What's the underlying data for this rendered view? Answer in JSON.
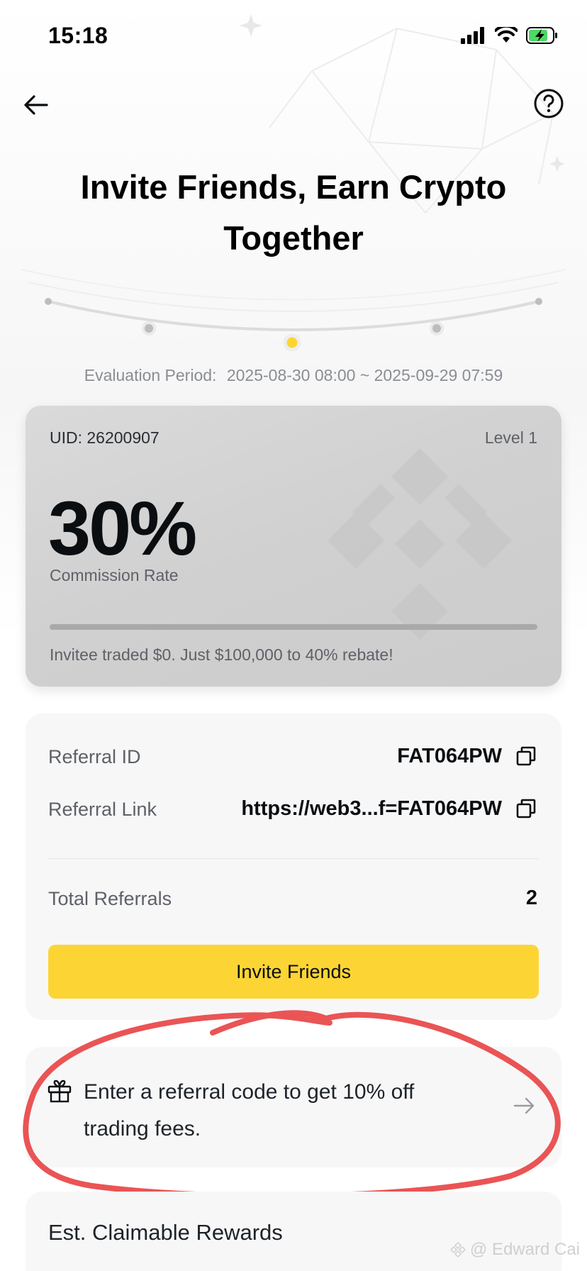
{
  "status_bar": {
    "time": "15:18",
    "icons": [
      "signal-icon",
      "wifi-icon",
      "battery-charging-icon"
    ]
  },
  "header": {
    "back_icon": "arrow-left-icon",
    "help_icon": "question-circle-icon",
    "title": "Invite Friends, Earn Crypto Together"
  },
  "evaluation": {
    "label": "Evaluation Period:",
    "value": "2025-08-30 08:00 ~ 2025-09-29 07:59"
  },
  "commission_card": {
    "uid": "UID: 26200907",
    "level": "Level 1",
    "rate": "30%",
    "rate_label": "Commission Rate",
    "progress_fraction": 0,
    "note": "Invitee traded $0. Just $100,000 to 40% rebate!",
    "colors": {
      "accent": "#f0b90b"
    }
  },
  "referral_panel": {
    "id_label": "Referral ID",
    "id_value": "FAT064PW",
    "link_label": "Referral Link",
    "link_value": "https://web3...f=FAT064PW",
    "total_label": "Total Referrals",
    "total_value": "2",
    "invite_button": "Invite Friends",
    "colors": {
      "button": "#fcd535"
    }
  },
  "promo": {
    "icon": "gift-icon",
    "text": "Enter a referral code to get 10% off trading fees.",
    "arrow_icon": "arrow-right-icon"
  },
  "rewards": {
    "title": "Est. Claimable Rewards"
  },
  "watermark": {
    "text": "@ Edward Cai"
  }
}
